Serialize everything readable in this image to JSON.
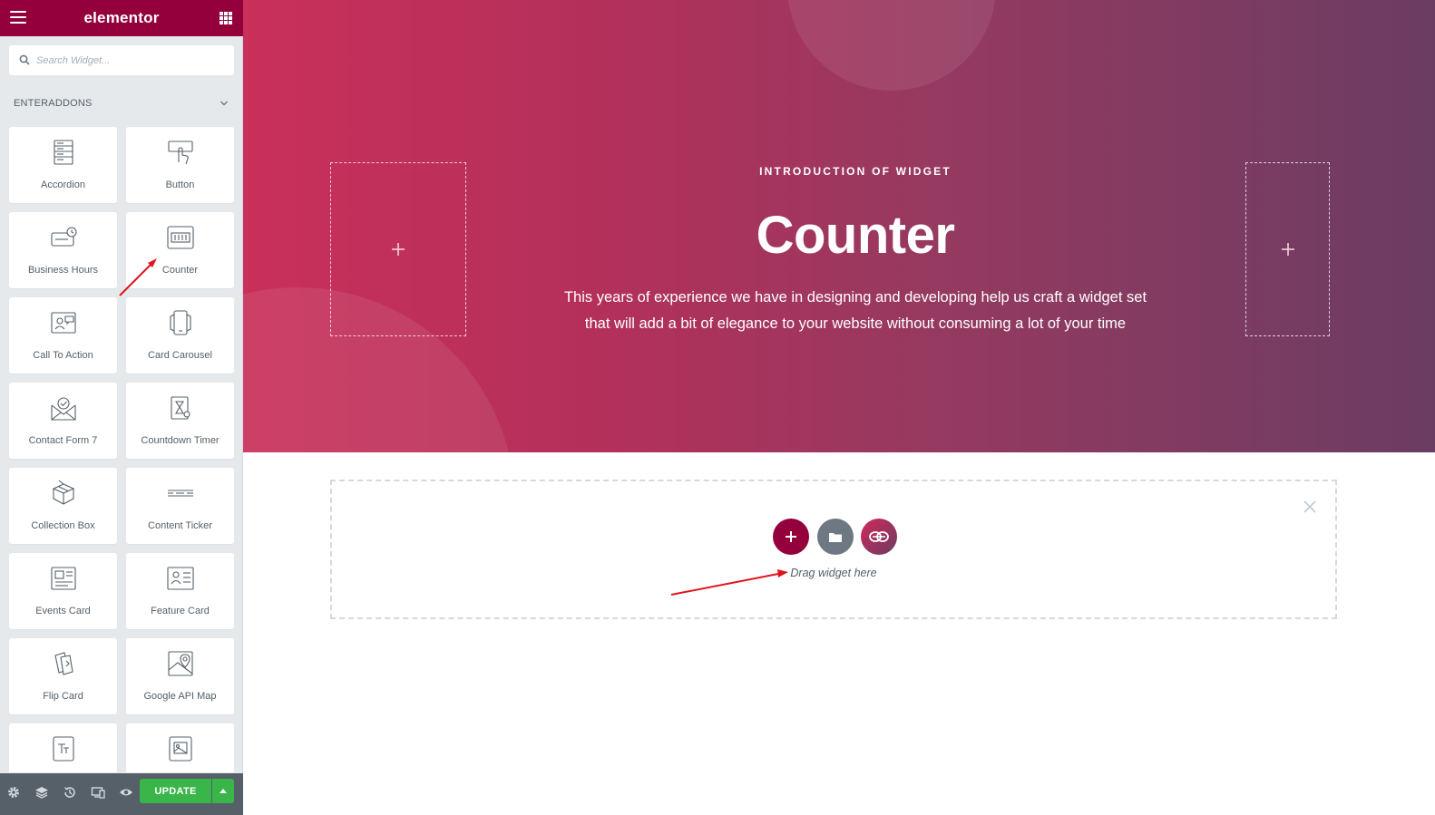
{
  "app": {
    "brand": "elementor",
    "brand_color": "#93003c",
    "menu_icon": "hamburger-icon",
    "apps_icon": "grid-icon"
  },
  "search": {
    "placeholder": "Search Widget...",
    "value": "",
    "icon": "search-icon"
  },
  "category": {
    "label": "ENTERADDONS",
    "expanded": true
  },
  "widgets": [
    {
      "label": "Accordion",
      "icon": "accordion-icon"
    },
    {
      "label": "Button",
      "icon": "button-icon"
    },
    {
      "label": "Business Hours",
      "icon": "business-hours-icon"
    },
    {
      "label": "Counter",
      "icon": "counter-icon"
    },
    {
      "label": "Call To Action",
      "icon": "call-to-action-icon"
    },
    {
      "label": "Card Carousel",
      "icon": "card-carousel-icon"
    },
    {
      "label": "Contact Form 7",
      "icon": "contact-form-icon"
    },
    {
      "label": "Countdown Timer",
      "icon": "countdown-timer-icon"
    },
    {
      "label": "Collection Box",
      "icon": "collection-box-icon"
    },
    {
      "label": "Content Ticker",
      "icon": "content-ticker-icon"
    },
    {
      "label": "Events Card",
      "icon": "events-card-icon"
    },
    {
      "label": "Feature Card",
      "icon": "feature-card-icon"
    },
    {
      "label": "Flip Card",
      "icon": "flip-card-icon"
    },
    {
      "label": "Google API Map",
      "icon": "google-map-icon"
    },
    {
      "label": "",
      "icon": "text-widget-icon"
    },
    {
      "label": "",
      "icon": "image-widget-icon"
    }
  ],
  "footer": {
    "icons": [
      "settings-icon",
      "navigator-icon",
      "history-icon",
      "responsive-icon",
      "preview-icon"
    ],
    "update_label": "UPDATE",
    "update_color": "#39b54a"
  },
  "hero": {
    "kicker": "INTRODUCTION OF WIDGET",
    "title": "Counter",
    "description_line1": "This years of experience we have in designing and developing help us craft a widget set",
    "description_line2": "that will add a bit of elegance to your website without consuming a lot of your time",
    "gradient_start": "#c9305a",
    "gradient_end": "#6b3c63"
  },
  "drop_area": {
    "hint": "Drag widget here",
    "add_icon": "plus-icon",
    "template_icon": "folder-icon",
    "addon_icon": "enteraddons-logo-icon",
    "close_icon": "close-icon"
  },
  "annotations": {
    "arrow_color": "#e0141e"
  }
}
